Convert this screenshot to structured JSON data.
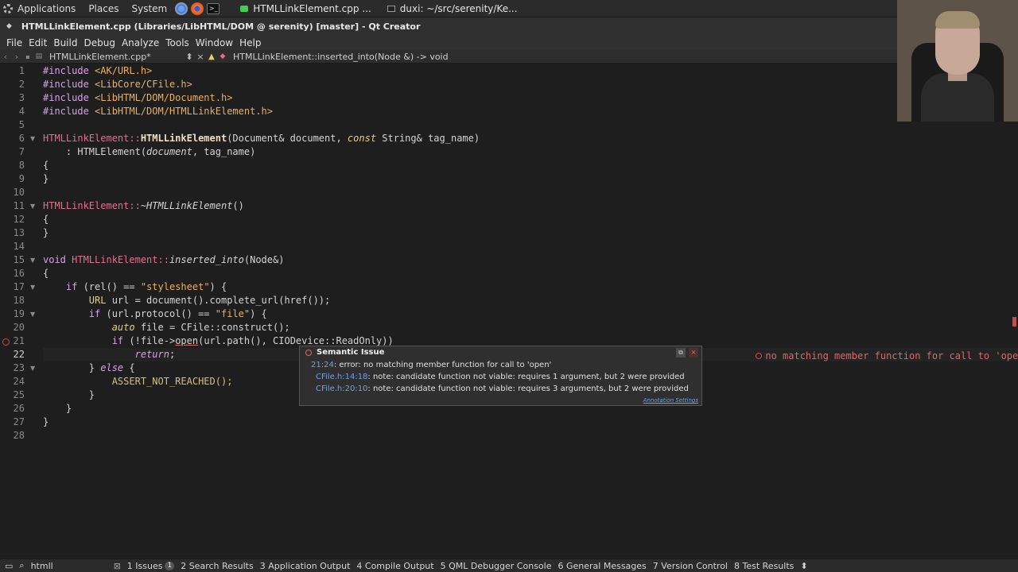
{
  "panel": {
    "applications": "Applications",
    "places": "Places",
    "system": "System",
    "tasks": [
      {
        "label": "HTMLLinkElement.cpp ..."
      },
      {
        "label": "duxi: ~/src/serenity/Ke..."
      }
    ]
  },
  "window": {
    "title": "HTMLLinkElement.cpp (Libraries/LibHTML/DOM @ serenity) [master] - Qt Creator"
  },
  "menu": [
    "File",
    "Edit",
    "Build",
    "Debug",
    "Analyze",
    "Tools",
    "Window",
    "Help"
  ],
  "doc": {
    "filename": "HTMLLinkElement.cpp*",
    "symbol": "HTMLLinkElement::inserted_into(Node &) -> void"
  },
  "colors": {
    "background": "#1e1e1e",
    "error": "#e06666",
    "keyword": "#d8a0e8",
    "link": "#6aa2e8"
  },
  "lines": [
    {
      "n": "1"
    },
    {
      "n": "2"
    },
    {
      "n": "3"
    },
    {
      "n": "4"
    },
    {
      "n": "5"
    },
    {
      "n": "6"
    },
    {
      "n": "7"
    },
    {
      "n": "8"
    },
    {
      "n": "9"
    },
    {
      "n": "10"
    },
    {
      "n": "11"
    },
    {
      "n": "12"
    },
    {
      "n": "13"
    },
    {
      "n": "14"
    },
    {
      "n": "15"
    },
    {
      "n": "16"
    },
    {
      "n": "17"
    },
    {
      "n": "18"
    },
    {
      "n": "19"
    },
    {
      "n": "20"
    },
    {
      "n": "21"
    },
    {
      "n": "22"
    },
    {
      "n": "23"
    },
    {
      "n": "24"
    },
    {
      "n": "25"
    },
    {
      "n": "26"
    },
    {
      "n": "27"
    },
    {
      "n": "28"
    }
  ],
  "code": {
    "l1_a": "#include ",
    "l1_b": "<AK/URL.h>",
    "l2_a": "#include ",
    "l2_b": "<LibCore/CFile.h>",
    "l3_a": "#include ",
    "l3_b": "<LibHTML/DOM/Document.h>",
    "l4_a": "#include ",
    "l4_b": "<LibHTML/DOM/HTMLLinkElement.h>",
    "l6_a": "HTMLLinkElement::",
    "l6_b": "HTMLLinkElement",
    "l6_c": "(Document& document, ",
    "l6_d": "const",
    "l6_e": " String& tag_name)",
    "l7_a": "    : HTMLElement(",
    "l7_b": "document",
    "l7_c": ", tag_name)",
    "l8": "{",
    "l9": "}",
    "l11_a": "HTMLLinkElement::",
    "l11_b": "~HTMLLinkElement",
    "l11_c": "()",
    "l12": "{",
    "l13": "}",
    "l15_a": "void",
    "l15_b": " HTMLLinkElement::",
    "l15_c": "inserted_into",
    "l15_d": "(Node&)",
    "l16": "{",
    "l17_a": "    if",
    "l17_b": " (rel() == ",
    "l17_c": "\"stylesheet\"",
    "l17_d": ") {",
    "l18_a": "        URL",
    "l18_b": " url = document().complete_url(href());",
    "l19_a": "        if",
    "l19_b": " (url.protocol() == ",
    "l19_c": "\"file\"",
    "l19_d": ") {",
    "l20_a": "            auto",
    "l20_b": " file = CFile::construct();",
    "l21_a": "            if",
    "l21_b": " (!file->",
    "l21_c": "open",
    "l21_d": "(url.path(), CIODevice::ReadOnly))",
    "l22_a": "                return",
    "l22_b": ";",
    "l23_a": "        } ",
    "l23_b": "else",
    "l23_c": " {",
    "l24": "            ASSERT_NOT_REACHED();",
    "l25": "        }",
    "l26": "    }",
    "l27": "}"
  },
  "inline_error": "no matching member function for call to 'open'",
  "tooltip": {
    "title": "Semantic Issue",
    "row1_loc": "21:24",
    "row1_text": ": error: no matching member function for call to 'open'",
    "row2_loc": "CFile.h:14:18",
    "row2_text": ": note: candidate function not viable: requires 1 argument, but 2 were provided",
    "row3_loc": "CFile.h:20:10",
    "row3_text": ": note: candidate function not viable: requires 3 arguments, but 2 were provided",
    "link": "Annotation Settings"
  },
  "status": {
    "locator": "htmll",
    "panes": [
      {
        "label": "1 Issues",
        "badge": "1"
      },
      {
        "label": "2 Search Results"
      },
      {
        "label": "3 Application Output"
      },
      {
        "label": "4 Compile Output"
      },
      {
        "label": "5 QML Debugger Console"
      },
      {
        "label": "6 General Messages"
      },
      {
        "label": "7 Version Control"
      },
      {
        "label": "8 Test Results"
      }
    ]
  }
}
